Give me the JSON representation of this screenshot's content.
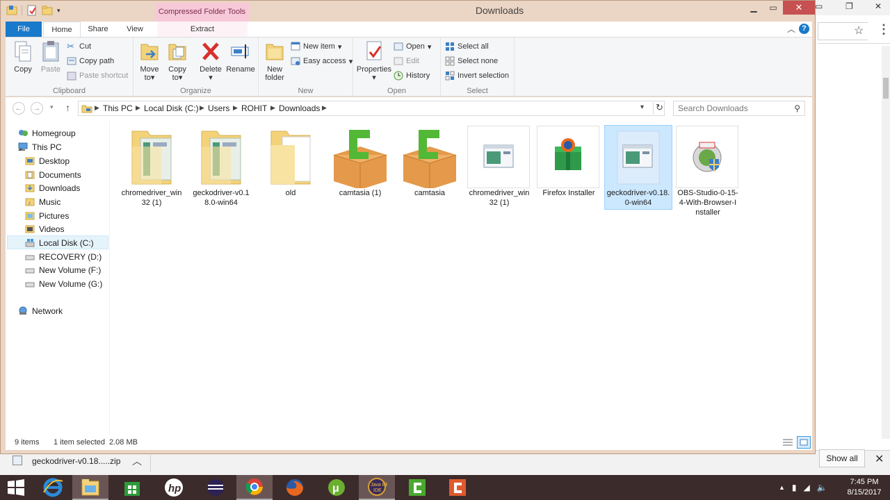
{
  "window": {
    "title": "Downloads",
    "context_tab_group": "Compressed Folder Tools"
  },
  "tabs": {
    "file": "File",
    "home": "Home",
    "share": "Share",
    "view": "View",
    "extract": "Extract"
  },
  "ribbon": {
    "clipboard": {
      "label": "Clipboard",
      "copy": "Copy",
      "paste": "Paste",
      "cut": "Cut",
      "copy_path": "Copy path",
      "paste_shortcut": "Paste shortcut"
    },
    "organize": {
      "label": "Organize",
      "move_to": "Move",
      "move_to_2": "to",
      "copy_to": "Copy",
      "copy_to_2": "to",
      "delete": "Delete",
      "rename": "Rename"
    },
    "new": {
      "label": "New",
      "new_folder": "New",
      "new_folder_2": "folder",
      "new_item": "New item",
      "easy_access": "Easy access"
    },
    "open": {
      "label": "Open",
      "properties": "Properties",
      "open": "Open",
      "edit": "Edit",
      "history": "History"
    },
    "select": {
      "label": "Select",
      "select_all": "Select all",
      "select_none": "Select none",
      "invert_selection": "Invert selection"
    }
  },
  "address": {
    "crumbs": [
      "This PC",
      "Local Disk (C:)",
      "Users",
      "ROHIT",
      "Downloads"
    ],
    "search_placeholder": "Search Downloads"
  },
  "navpane": {
    "homegroup": "Homegroup",
    "this_pc": "This PC",
    "items": [
      "Desktop",
      "Documents",
      "Downloads",
      "Music",
      "Pictures",
      "Videos",
      "Local Disk (C:)",
      "RECOVERY (D:)",
      "New Volume (F:)",
      "New Volume (G:)"
    ],
    "network": "Network"
  },
  "files": [
    {
      "name": "chromedriver_win32 (1)",
      "type": "zip-folder"
    },
    {
      "name": "geckodriver-v0.18.0-win64",
      "type": "zip-folder"
    },
    {
      "name": "old",
      "type": "folder"
    },
    {
      "name": "camtasia (1)",
      "type": "camtasia-box"
    },
    {
      "name": "camtasia",
      "type": "camtasia-box"
    },
    {
      "name": "chromedriver_win32 (1)",
      "type": "app-window"
    },
    {
      "name": "Firefox Installer",
      "type": "firefox-installer"
    },
    {
      "name": "geckodriver-v0.18.0-win64",
      "type": "app-window",
      "selected": true
    },
    {
      "name": "OBS-Studio-0-15-4-With-Browser-Installer",
      "type": "obs-installer"
    }
  ],
  "status": {
    "count": "9 items",
    "selected": "1 item selected",
    "size": "2.08 MB"
  },
  "download_bar": {
    "file": "geckodriver-v0.18.....zip",
    "show_all": "Show all"
  },
  "taskbar": {
    "apps": [
      "internet-explorer",
      "file-explorer",
      "store",
      "hp",
      "eclipse",
      "chrome",
      "firefox",
      "utorrent",
      "java-ee-ide",
      "camtasia-recorder",
      "camtasia-studio"
    ],
    "time": "7:45 PM",
    "date": "8/15/2017"
  },
  "colors": {
    "accent": "#1979ca",
    "selection": "#cce8ff",
    "context_tab": "#f7c9d8",
    "window_frame": "#ebd5c4",
    "taskbar": "#3c2b2b",
    "close_button": "#c75050"
  }
}
